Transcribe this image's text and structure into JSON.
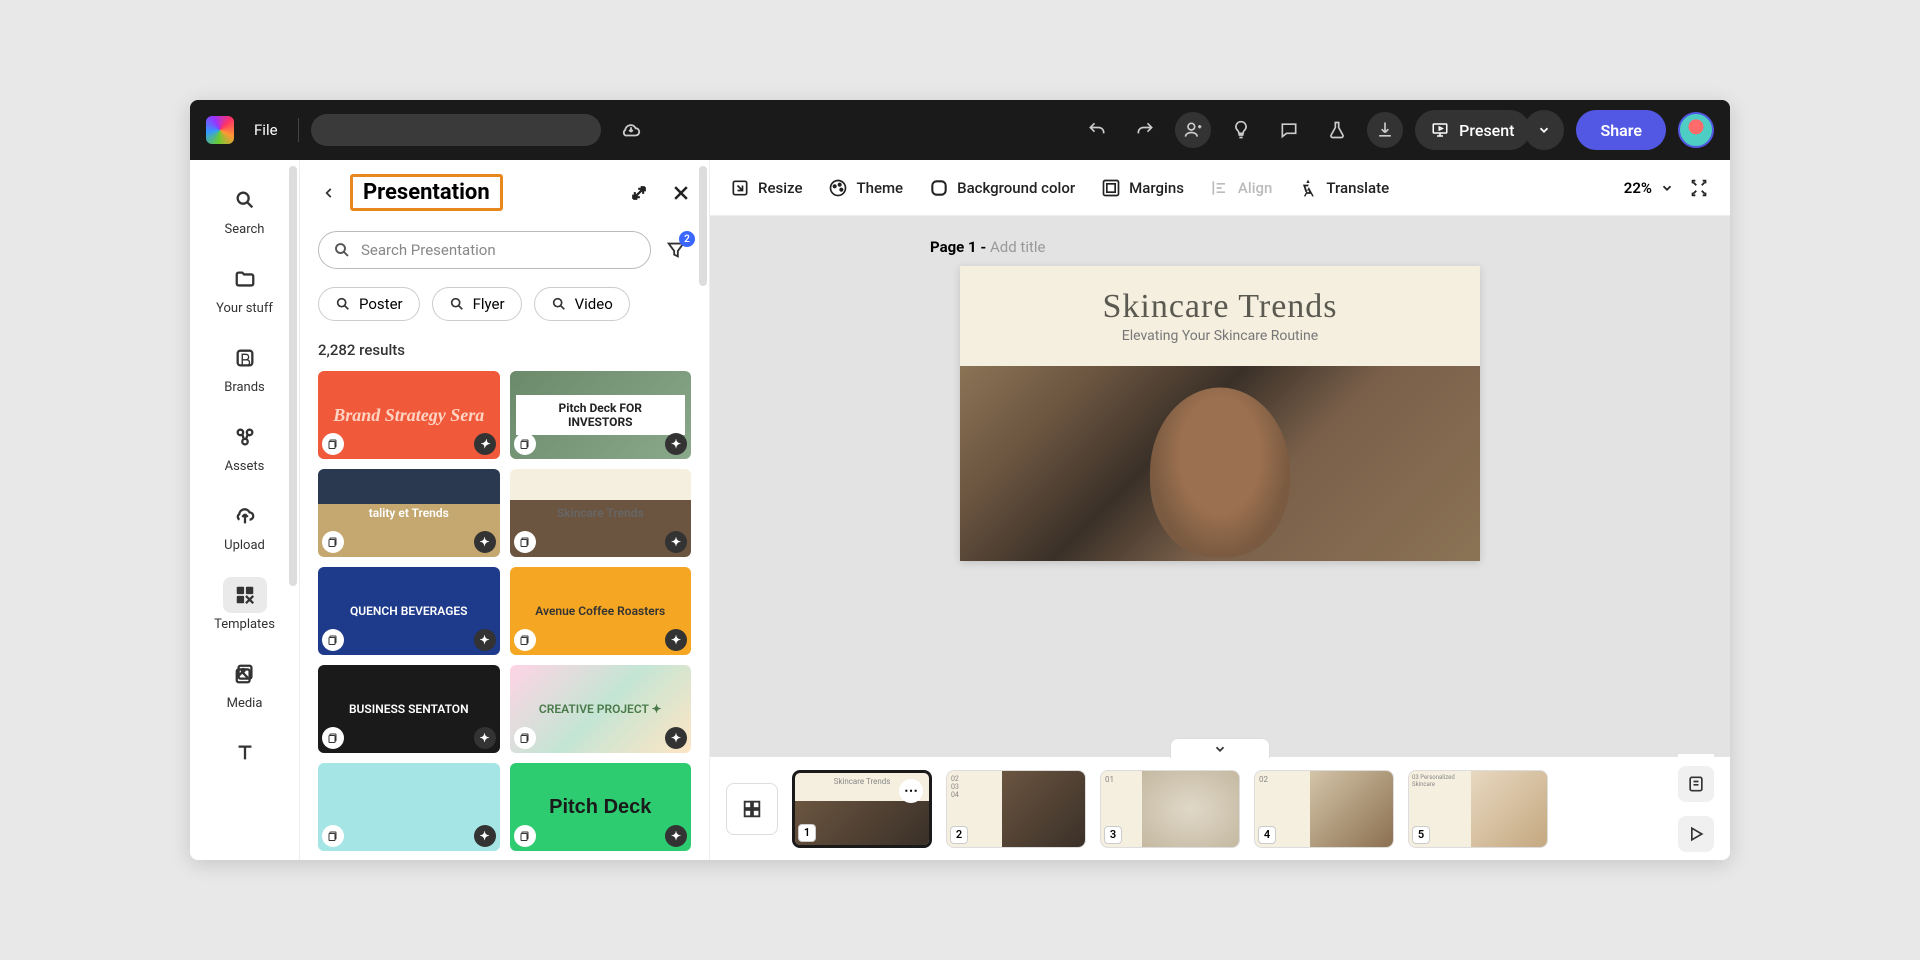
{
  "topbar": {
    "file_label": "File",
    "present_label": "Present",
    "share_label": "Share"
  },
  "rail": {
    "items": [
      {
        "label": "Search"
      },
      {
        "label": "Your stuff"
      },
      {
        "label": "Brands"
      },
      {
        "label": "Assets"
      },
      {
        "label": "Upload"
      },
      {
        "label": "Templates"
      },
      {
        "label": "Media"
      }
    ]
  },
  "panel": {
    "title": "Presentation",
    "search_placeholder": "Search Presentation",
    "filter_badge": "2",
    "chips": [
      {
        "label": "Poster"
      },
      {
        "label": "Flyer"
      },
      {
        "label": "Video"
      }
    ],
    "results_count": "2,282 results",
    "templates": [
      {
        "title": "Brand Strategy Sera",
        "bg": "#f05a3a",
        "fg": "#ffd4c4",
        "font": "italic 700 18px Georgia,serif"
      },
      {
        "title": "Pitch Deck FOR INVESTORS",
        "bg": "linear-gradient(135deg,#6a8a6a,#8aa88a)",
        "fg": "#222",
        "inner": true
      },
      {
        "title": "tality et Trends",
        "bg": "linear-gradient(180deg,#2a3850 40%,#c4a870 40%)",
        "fg": "#fff"
      },
      {
        "title": "Skincare Trends",
        "bg": "linear-gradient(180deg,#f5efe0 35%,#6b5540 35%)",
        "fg": "#666"
      },
      {
        "title": "QUENCH BEVERAGES",
        "bg": "#1e3a8a",
        "fg": "#fff",
        "pattern": true
      },
      {
        "title": "Avenue Coffee Roasters",
        "bg": "#f5a623",
        "fg": "#333"
      },
      {
        "title": "BUSINESS SENTATON",
        "bg": "#1a1a1a",
        "fg": "#fff"
      },
      {
        "title": "CREATIVE PROJECT ✦",
        "bg": "linear-gradient(135deg,#ffd4e5,#c4e5d4,#ffe5c4)",
        "fg": "#4a7a4a"
      },
      {
        "title": "",
        "bg": "#a5e5e5",
        "fg": "#333"
      },
      {
        "title": "Pitch Deck",
        "bg": "#2ecc71",
        "fg": "#1a1a1a",
        "font": "700 20px sans-serif"
      }
    ]
  },
  "canvas_toolbar": {
    "resize": "Resize",
    "theme": "Theme",
    "bgcolor": "Background color",
    "margins": "Margins",
    "align": "Align",
    "translate": "Translate",
    "zoom": "22%"
  },
  "stage": {
    "page_prefix": "Page 1 - ",
    "page_placeholder": "Add title",
    "slide_title": "Skincare Trends",
    "slide_subtitle": "Elevating Your Skincare Routine"
  },
  "filmstrip": {
    "thumbs": [
      {
        "num": "1",
        "label": "Skincare Trends"
      },
      {
        "num": "2",
        "label": "02"
      },
      {
        "num": "3",
        "label": "01"
      },
      {
        "num": "4",
        "label": "02"
      },
      {
        "num": "5",
        "label": "03 Personalized Skincare"
      }
    ]
  }
}
